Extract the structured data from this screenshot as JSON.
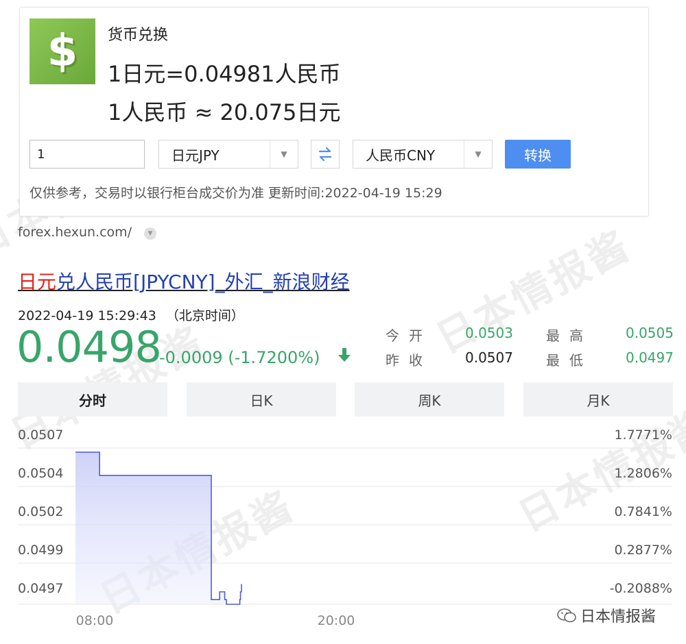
{
  "converter": {
    "title": "货币兑换",
    "rate_line_1": "1日元=0.04981人民币",
    "rate_line_2": "1人民币 ≈ 20.075日元",
    "amount_value": "1",
    "from_currency": "日元JPY",
    "to_currency": "人民币CNY",
    "convert_label": "转换",
    "disclaimer": "仅供参考，交易时以银行柜台成交价为准 更新时间:2022-04-19 15:29",
    "icon": "dollar-icon",
    "accent_color": "#4e8ef0"
  },
  "source_url": "forex.hexun.com/",
  "result": {
    "title_highlight": "日元",
    "title_rest": "兑人民币[JPYCNY]_外汇_新浪财经",
    "timestamp": "2022-04-19 15:29:43",
    "timezone": "（北京时间）",
    "price": "0.0498",
    "change": "-0.0009 (-1.7200%)",
    "change_color": "#38a56a"
  },
  "stats": {
    "open_label": "今开",
    "open_value": "0.0503",
    "prev_close_label": "昨收",
    "prev_close_value": "0.0507",
    "high_label": "最高",
    "high_value": "0.0505",
    "low_label": "最低",
    "low_value": "0.0497"
  },
  "tabs": [
    {
      "label": "分时",
      "active": true
    },
    {
      "label": "日K",
      "active": false
    },
    {
      "label": "周K",
      "active": false
    },
    {
      "label": "月K",
      "active": false
    }
  ],
  "watermark_text": "日本情报酱",
  "wechat_label": "日本情报酱",
  "chart_data": {
    "type": "line",
    "title": "",
    "xlabel": "",
    "ylabel": "",
    "x_tick_labels": [
      "08:00",
      "20:00"
    ],
    "y_ticks_left": [
      "0.0507",
      "0.0504",
      "0.0502",
      "0.0499",
      "0.0497"
    ],
    "y_ticks_right": [
      "1.7771%",
      "1.2806%",
      "0.7841%",
      "0.2877%",
      "-0.2088%"
    ],
    "ylim": [
      0.04962,
      0.0507
    ],
    "grid": true,
    "area_fill": true,
    "line_color": "#4a5fd8",
    "series": [
      {
        "x": [
          "07:00",
          "08:00",
          "08:12",
          "09:00",
          "10:00",
          "11:00",
          "12:00",
          "12:30",
          "13:00",
          "13:40",
          "13:45",
          "14:00",
          "14:10",
          "14:20",
          "14:25",
          "14:30",
          "14:35",
          "14:40",
          "14:45",
          "15:10",
          "15:12",
          "15:15"
        ],
        "values": [
          0.0506,
          0.0506,
          0.05045,
          0.05045,
          0.05045,
          0.05045,
          0.05045,
          0.05045,
          0.05045,
          0.05045,
          0.04965,
          0.04965,
          0.0497,
          0.0497,
          0.04965,
          0.04962,
          0.04962,
          0.04962,
          0.04962,
          0.04965,
          0.0497,
          0.04975
        ]
      }
    ]
  }
}
